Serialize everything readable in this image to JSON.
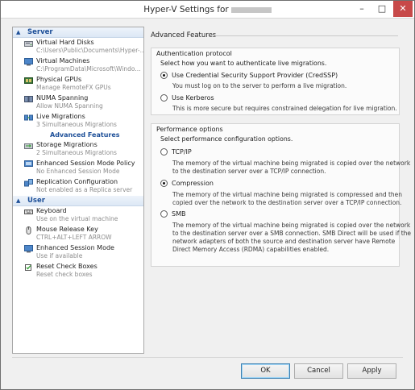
{
  "window": {
    "title": "Hyper-V Settings for",
    "controls": {
      "minimize": "–",
      "maximize": "□",
      "close": "✕"
    }
  },
  "sidebar": {
    "sections": [
      {
        "label": "Server",
        "icon": "chevron-up-icon",
        "items": [
          {
            "name": "Virtual Hard Disks",
            "detail": "C:\\Users\\Public\\Documents\\Hyper-...",
            "icon": "hard-disk-icon"
          },
          {
            "name": "Virtual Machines",
            "detail": "C:\\ProgramData\\Microsoft\\Windo...",
            "icon": "virtual-machine-icon"
          },
          {
            "name": "Physical GPUs",
            "detail": "Manage RemoteFX GPUs",
            "icon": "gpu-icon"
          },
          {
            "name": "NUMA Spanning",
            "detail": "Allow NUMA Spanning",
            "icon": "numa-icon"
          },
          {
            "name": "Live Migrations",
            "detail": "3 Simultaneous Migrations",
            "icon": "live-migration-icon"
          },
          {
            "name": "Advanced Features",
            "detail": "",
            "icon": "",
            "sub": true,
            "selected": true
          },
          {
            "name": "Storage Migrations",
            "detail": "2 Simultaneous Migrations",
            "icon": "storage-migration-icon"
          },
          {
            "name": "Enhanced Session Mode Policy",
            "detail": "No Enhanced Session Mode",
            "icon": "session-policy-icon"
          },
          {
            "name": "Replication Configuration",
            "detail": "Not enabled as a Replica server",
            "icon": "replication-icon"
          }
        ]
      },
      {
        "label": "User",
        "icon": "chevron-up-icon",
        "items": [
          {
            "name": "Keyboard",
            "detail": "Use on the virtual machine",
            "icon": "keyboard-icon"
          },
          {
            "name": "Mouse Release Key",
            "detail": "CTRL+ALT+LEFT ARROW",
            "icon": "mouse-icon"
          },
          {
            "name": "Enhanced Session Mode",
            "detail": "Use if available",
            "icon": "session-icon"
          },
          {
            "name": "Reset Check Boxes",
            "detail": "Reset check boxes",
            "icon": "checkbox-icon"
          }
        ]
      }
    ]
  },
  "main": {
    "header": "Advanced Features",
    "auth": {
      "title": "Authentication protocol",
      "prompt": "Select how you want to authenticate live migrations.",
      "options": [
        {
          "label": "Use Credential Security Support Provider (CredSSP)",
          "selected": true,
          "desc": [
            "You must log on to the server to perform a live migration."
          ]
        },
        {
          "label": "Use Kerberos",
          "selected": false,
          "desc": [
            "This is more secure but requires constrained delegation for live migration."
          ]
        }
      ]
    },
    "perf": {
      "title": "Performance options",
      "prompt": "Select performance configuration options.",
      "options": [
        {
          "label": "TCP/IP",
          "selected": false,
          "desc": [
            "The memory of the virtual machine being migrated is copied over the network",
            "to the destination server over a TCP/IP connection."
          ]
        },
        {
          "label": "Compression",
          "selected": true,
          "desc": [
            "The memory of the virtual machine being migrated is compressed and then",
            "copied over the network to the destination server over a TCP/IP connection."
          ]
        },
        {
          "label": "SMB",
          "selected": false,
          "desc": [
            "The memory of the virtual machine being migrated is copied over the network",
            "to the destination server over a SMB connection. SMB Direct will be used if the",
            "network adapters of both the source and destination server have Remote",
            "Direct Memory Access (RDMA) capabilities enabled."
          ]
        }
      ]
    }
  },
  "buttons": {
    "ok": "OK",
    "cancel": "Cancel",
    "apply": "Apply"
  },
  "colors": {
    "accent": "#1d4f98",
    "close": "#c74949"
  }
}
